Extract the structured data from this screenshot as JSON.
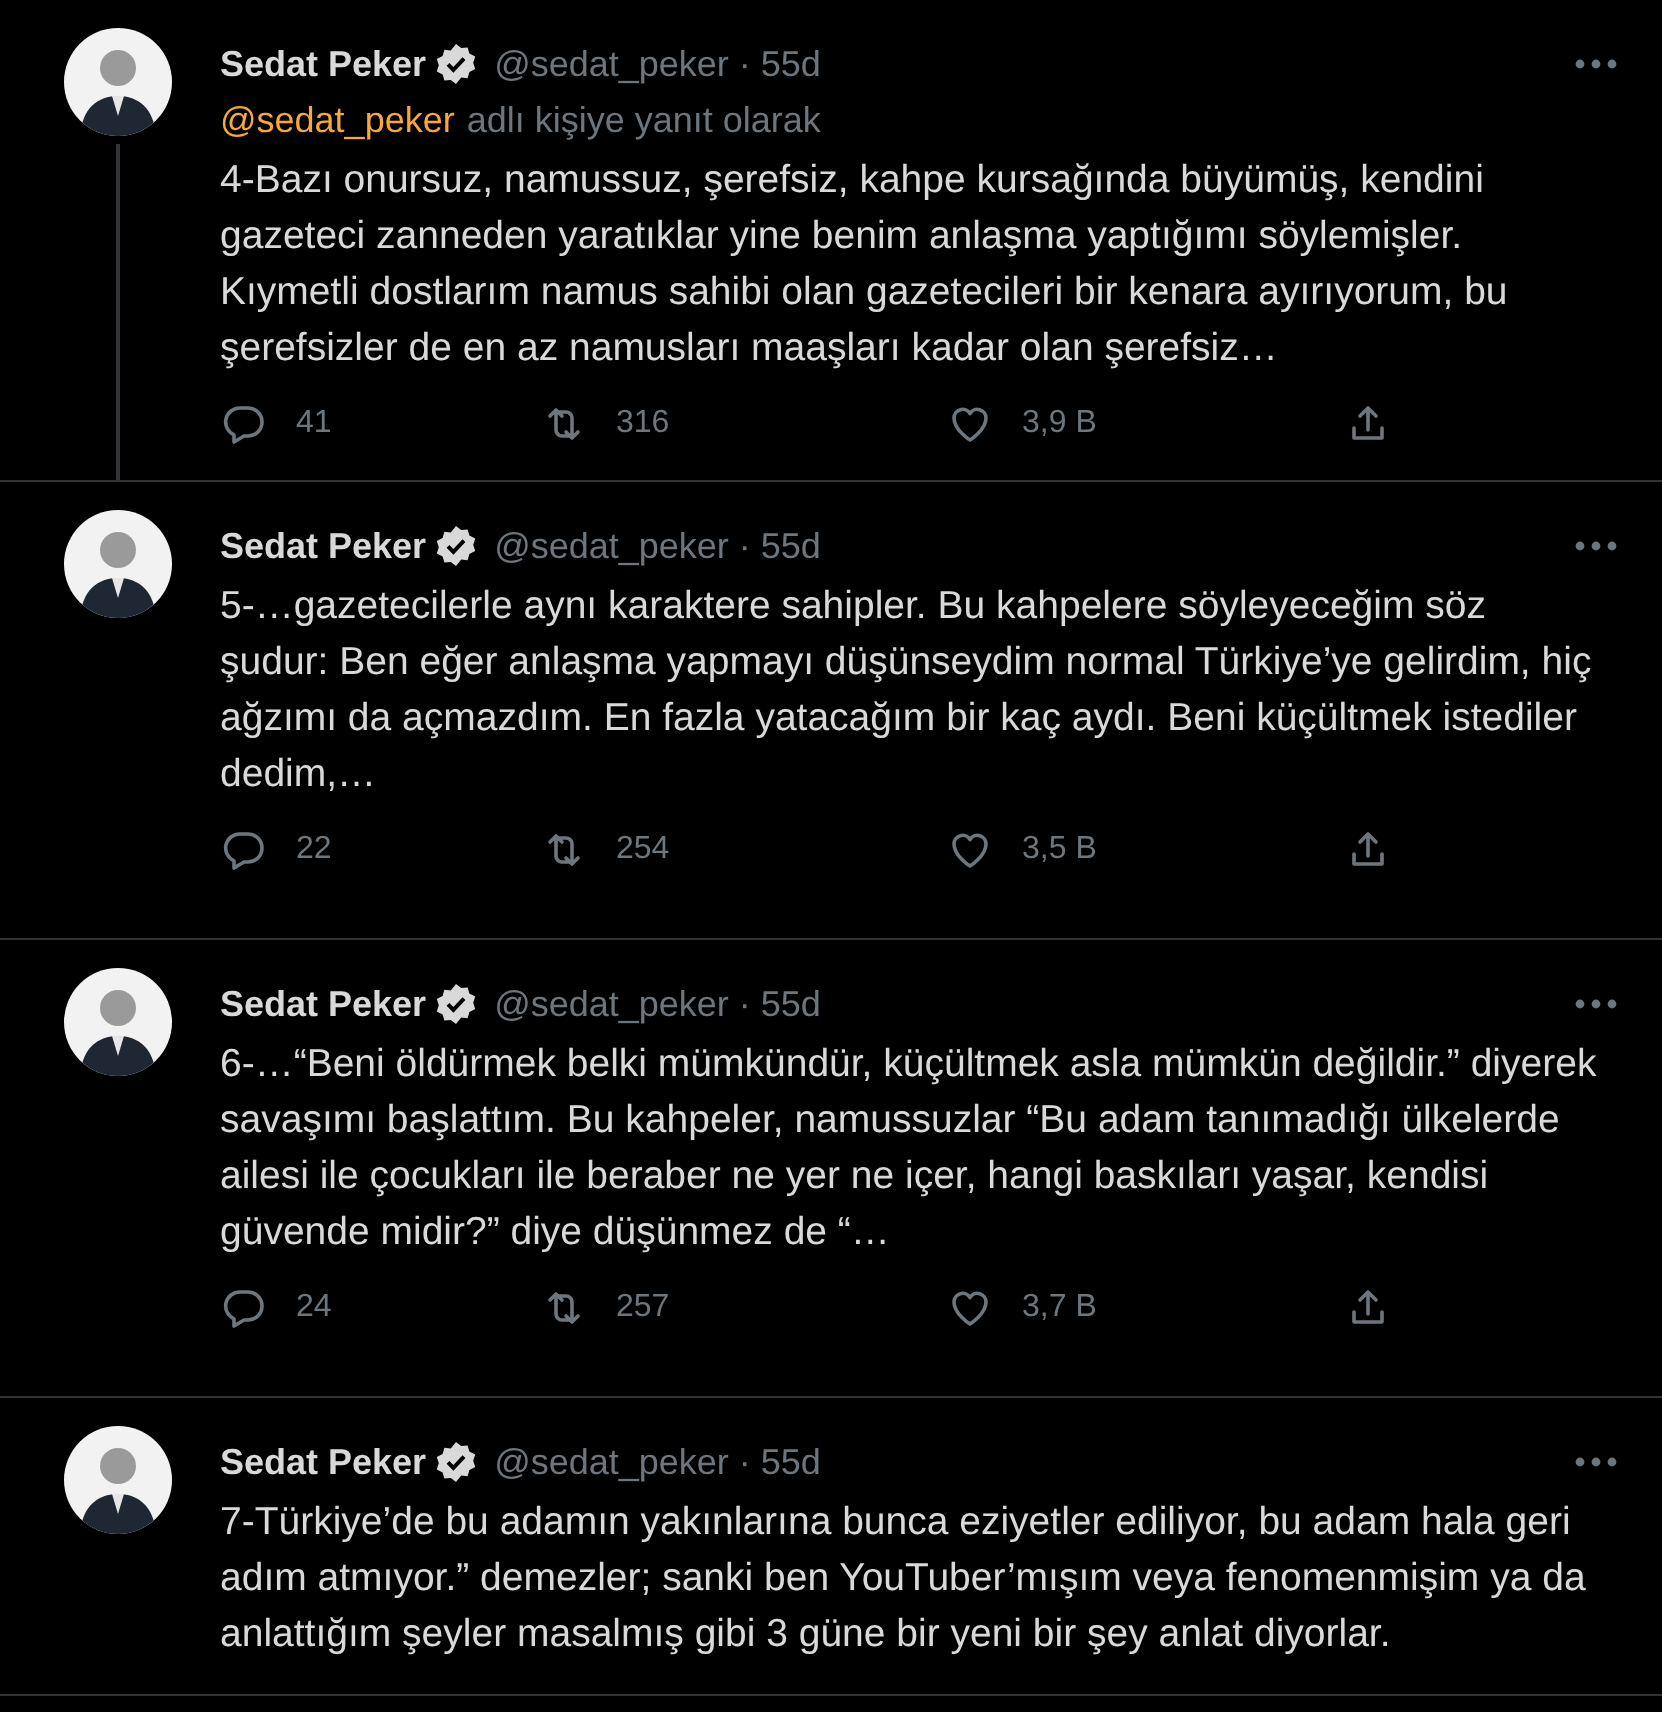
{
  "tweets": [
    {
      "name": "Sedat Peker",
      "verified": true,
      "meta": "@sedat_peker · 55d",
      "thread_line": true,
      "reply_to": {
        "handle": "@sedat_peker",
        "text": "adlı kişiye yanıt olarak"
      },
      "text": "4-Bazı onursuz, namussuz, şerefsiz, kahpe kursağında büyümüş, kendini gazeteci zanneden yaratıklar yine benim anlaşma yaptığımı söylemişler. Kıymetli dostlarım namus sahibi olan gazetecileri bir kenara ayırıyorum, bu şerefsizler de en az namusları maaşları kadar olan şerefsiz…",
      "stats": {
        "replies": "41",
        "retweets": "316",
        "likes": "3,9 B"
      }
    },
    {
      "name": "Sedat Peker",
      "verified": true,
      "meta": "@sedat_peker · 55d",
      "thread_line": false,
      "text": "5-…gazetecilerle aynı karaktere sahipler. Bu kahpelere söyleyeceğim söz şudur: Ben eğer anlaşma yapmayı düşünseydim normal Türkiye’ye gelirdim, hiç ağzımı da açmazdım. En fazla yatacağım bir kaç aydı. Beni küçültmek istediler dedim,…",
      "stats": {
        "replies": "22",
        "retweets": "254",
        "likes": "3,5 B"
      }
    },
    {
      "name": "Sedat Peker",
      "verified": true,
      "meta": "@sedat_peker · 55d",
      "thread_line": false,
      "text": "6-…“Beni öldürmek belki mümkündür, küçültmek asla mümkün değildir.” diyerek savaşımı başlattım. Bu kahpeler, namussuzlar “Bu adam tanımadığı ülkelerde ailesi ile çocukları ile beraber ne yer ne içer, hangi baskıları yaşar, kendisi güvende midir?” diye düşünmez de “…",
      "stats": {
        "replies": "24",
        "retweets": "257",
        "likes": "3,7 B"
      }
    },
    {
      "name": "Sedat Peker",
      "verified": true,
      "meta": "@sedat_peker · 55d",
      "thread_line": false,
      "text": "7-Türkiye’de bu adamın yakınlarına bunca eziyetler ediliyor, bu adam hala geri adım atmıyor.” demezler; sanki ben YouTuber’mışım veya fenomenmişim ya da anlattığım şeyler masalmış gibi 3 güne bir yeni bir şey anlat diyorlar."
    }
  ]
}
